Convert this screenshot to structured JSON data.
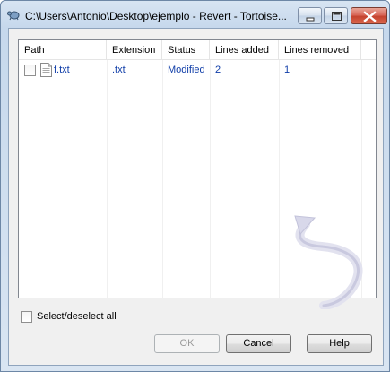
{
  "window": {
    "title": "C:\\Users\\Antonio\\Desktop\\ejemplo - Revert - Tortoise..."
  },
  "list": {
    "columns": [
      "Path",
      "Extension",
      "Status",
      "Lines added",
      "Lines removed"
    ],
    "rows": [
      {
        "checked": false,
        "path": "f.txt",
        "extension": ".txt",
        "status": "Modified",
        "lines_added": "2",
        "lines_removed": "1"
      }
    ]
  },
  "select_all": {
    "label": "Select/deselect all",
    "checked": false
  },
  "buttons": {
    "ok": "OK",
    "cancel": "Cancel",
    "help": "Help"
  },
  "icons": {
    "app": "tortoise-revert-icon",
    "minimize": "minimize-icon",
    "maximize": "maximize-icon",
    "close": "close-icon",
    "file": "text-file-icon",
    "watermark": "revert-arrow-icon"
  },
  "colors": {
    "link_text": "#0f3da8",
    "close_button": "#c5432f"
  }
}
